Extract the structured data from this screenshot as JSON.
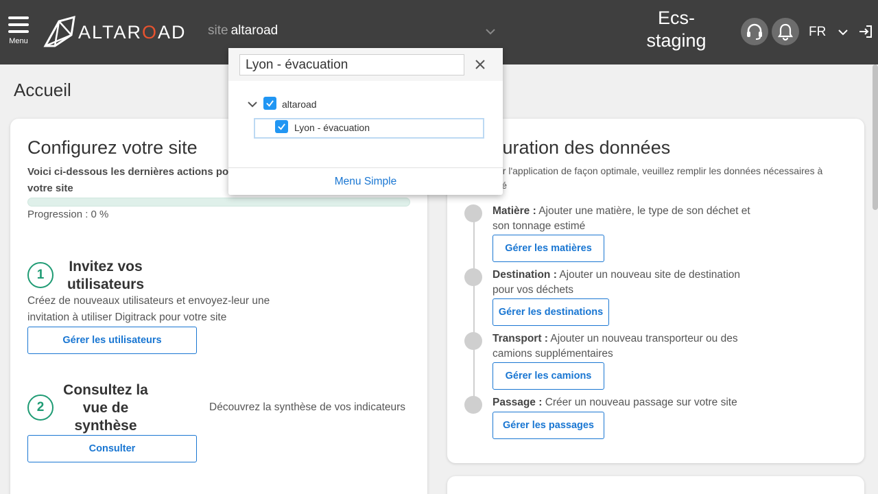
{
  "header": {
    "menu_label": "Menu",
    "logo": {
      "prefix": "ALTAR",
      "o": "O",
      "suffix": "AD"
    },
    "site_prefix": "site",
    "site_value": "altaroad",
    "env_line1": "Ecs-",
    "env_line2": "staging",
    "language": "FR"
  },
  "page": {
    "title": "Accueil"
  },
  "configure": {
    "title": "Configurez votre site",
    "subtitle_line1": "Voici ci-dessous les dernières actions po",
    "subtitle_line2": "votre site",
    "progress_fraction": 0,
    "progress_text": "Progression : 0 %",
    "steps": [
      {
        "number": "1",
        "title_line1": "Invitez vos",
        "title_line2": "utilisateurs",
        "desc_line1": "Créez de nouveaux utilisateurs et envoyez-leur une",
        "desc_line2": "invitation à utiliser Digitrack pour votre site",
        "button": "Gérer les utilisateurs"
      },
      {
        "number": "2",
        "title_line1": "Consultez la",
        "title_line2": "vue de",
        "title_line3": "synthèse",
        "desc": "Découvrez la synthèse de vos indicateurs",
        "button": "Consulter"
      }
    ]
  },
  "data_config": {
    "title": "figuration des données",
    "subtitle_line1": "ser l'application de façon optimale, veuillez remplir les données nécessaires à",
    "subtitle_line2": "ilité",
    "items": [
      {
        "label": "Matière :",
        "text_line1": "Ajouter une matière, le type de son déchet et",
        "text_line2": "son tonnage estimé",
        "button": "Gérer les matières"
      },
      {
        "label": "Destination :",
        "text_line1": "Ajouter un nouveau site de destination",
        "text_line2": "pour vos déchets",
        "button": "Gérer les destinations"
      },
      {
        "label": "Transport :",
        "text_line1": "Ajouter un nouveau transporteur ou des",
        "text_line2": "camions supplémentaires",
        "button": "Gérer les camions"
      },
      {
        "label": "Passage :",
        "text_line1": "Créer un nouveau passage sur votre site",
        "text_line2": "",
        "button": "Gérer les passages"
      }
    ]
  },
  "site_dropdown": {
    "search_value": "Lyon - évacuation",
    "tree": {
      "root": "altaroad",
      "child": "Lyon - évacuation"
    },
    "footer_link": "Menu Simple"
  },
  "colors": {
    "header_bg": "#3f3f3f",
    "accent_blue": "#1976d2",
    "accent_green": "#1f9b74",
    "logo_orange": "#e8532f",
    "checkbox_blue": "#2196f3"
  },
  "icons": [
    "hamburger-icon",
    "altaroad-logo",
    "chevron-down-icon",
    "headset-icon",
    "bell-icon",
    "logout-icon",
    "close-icon",
    "check-icon"
  ]
}
